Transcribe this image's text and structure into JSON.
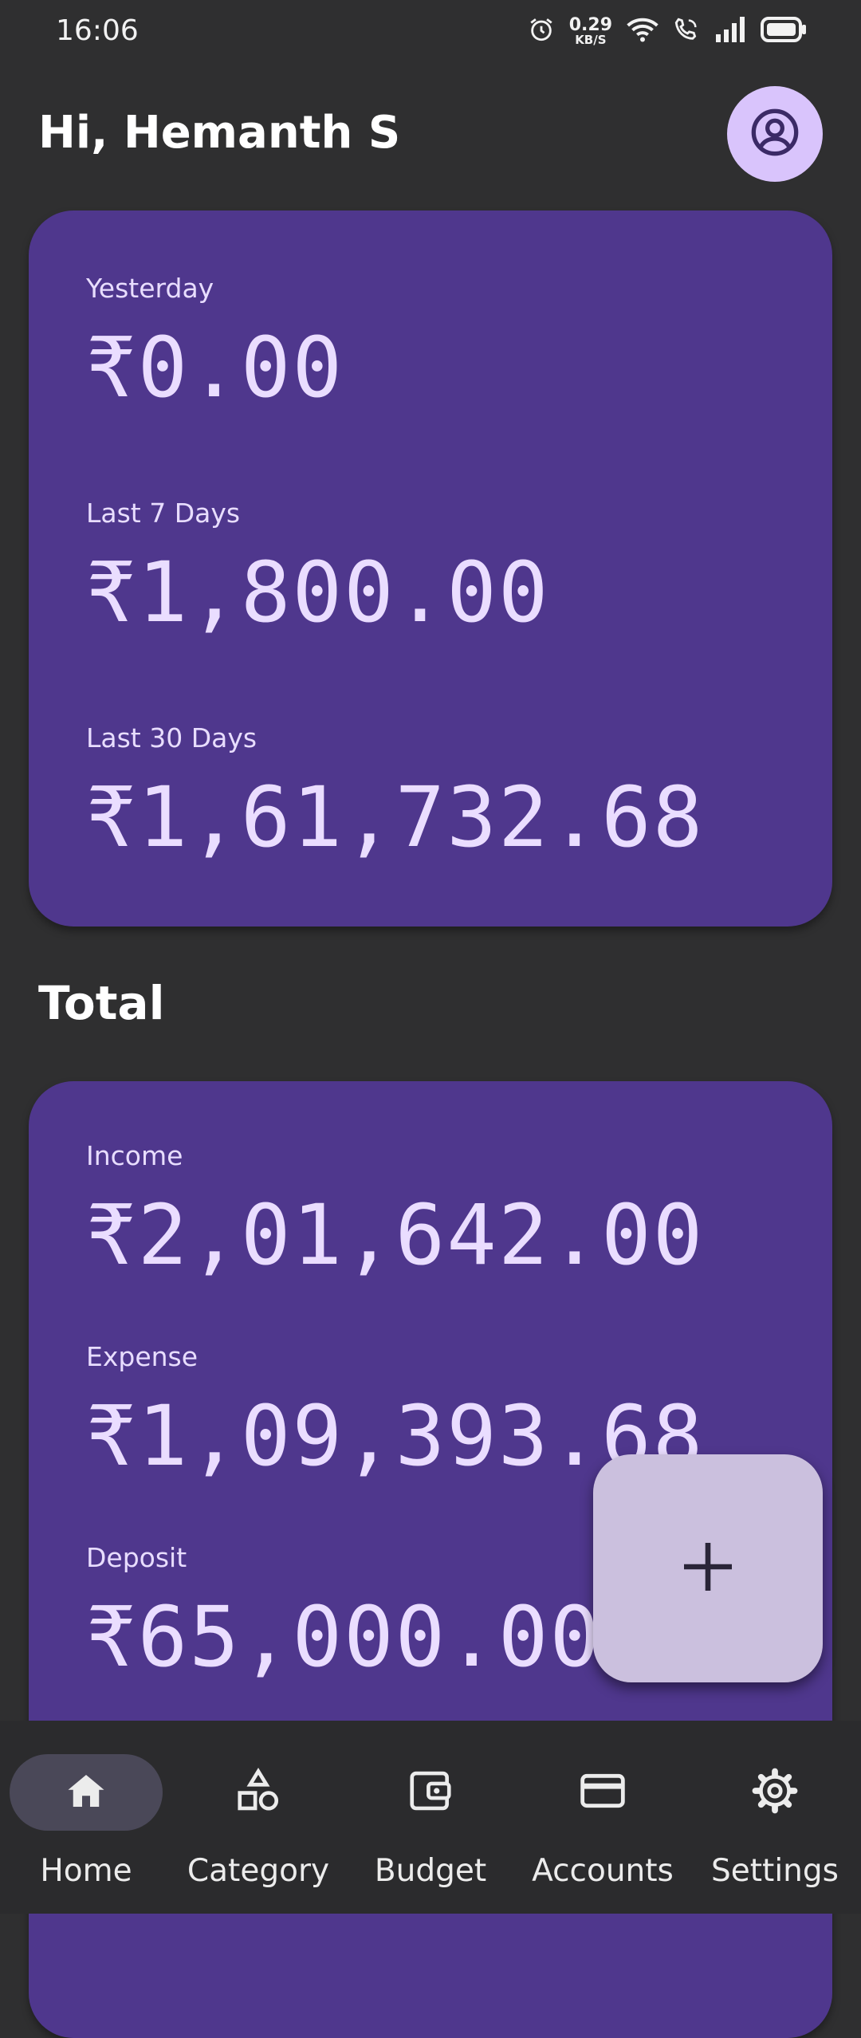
{
  "status_bar": {
    "time": "16:06",
    "net_speed_value": "0.29",
    "net_speed_unit": "KB/S",
    "icons": [
      "alarm-icon",
      "wifi-icon",
      "wifi-calling-icon",
      "signal-icon",
      "battery-icon"
    ]
  },
  "header": {
    "greeting": "Hi, Hemanth S",
    "profile_icon": "account-circle-icon"
  },
  "summary_card": {
    "items": [
      {
        "label": "Yesterday",
        "value": "₹0.00"
      },
      {
        "label": "Last 7 Days",
        "value": "₹1,800.00"
      },
      {
        "label": "Last 30 Days",
        "value": "₹1,61,732.68"
      }
    ]
  },
  "total_section": {
    "title": "Total",
    "items": [
      {
        "label": "Income",
        "value": "₹2,01,642.00"
      },
      {
        "label": "Expense",
        "value": "₹1,09,393.68"
      },
      {
        "label": "Deposit",
        "value": "₹65,000.00"
      }
    ]
  },
  "fab": {
    "icon": "plus-icon"
  },
  "bottom_nav": {
    "items": [
      {
        "label": "Home",
        "icon": "home-icon",
        "active": true
      },
      {
        "label": "Category",
        "icon": "shapes-icon",
        "active": false
      },
      {
        "label": "Budget",
        "icon": "wallet-icon",
        "active": false
      },
      {
        "label": "Accounts",
        "icon": "credit-card-icon",
        "active": false
      },
      {
        "label": "Settings",
        "icon": "gear-icon",
        "active": false
      }
    ]
  },
  "colors": {
    "background": "#2f2f30",
    "card": "#4f378d",
    "amount_text": "#eaddff",
    "profile_button": "#d9c4fc",
    "fab": "#cbc0de",
    "nav_active_pill": "#4a4858"
  }
}
